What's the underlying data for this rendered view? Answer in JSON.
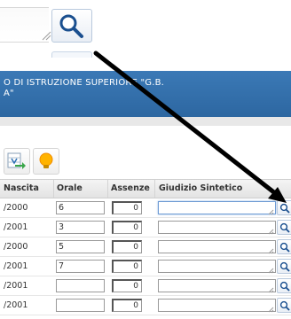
{
  "banner": {
    "line1": "O DI ISTRUZIONE SUPERIORE \"G.B.",
    "line2": "A\""
  },
  "toolbar": {
    "export_icon": "spreadsheet-export-icon",
    "tip_icon": "lightbulb-icon"
  },
  "table": {
    "headers": [
      "Nascita",
      "Orale",
      "Assenze",
      "Giudizio Sintetico"
    ],
    "rows": [
      {
        "nascita": "/2000",
        "orale": "6",
        "assenze": "0",
        "giudizio": ""
      },
      {
        "nascita": "/2001",
        "orale": "3",
        "assenze": "0",
        "giudizio": ""
      },
      {
        "nascita": "/2000",
        "orale": "5",
        "assenze": "0",
        "giudizio": ""
      },
      {
        "nascita": "/2001",
        "orale": "7",
        "assenze": "0",
        "giudizio": ""
      },
      {
        "nascita": "/2001",
        "orale": "",
        "assenze": "0",
        "giudizio": ""
      },
      {
        "nascita": "/2001",
        "orale": "",
        "assenze": "0",
        "giudizio": ""
      }
    ]
  },
  "colors": {
    "banner": "#2d67a1",
    "arrow": "#000000",
    "zoom_border": "#b9c9dd"
  }
}
